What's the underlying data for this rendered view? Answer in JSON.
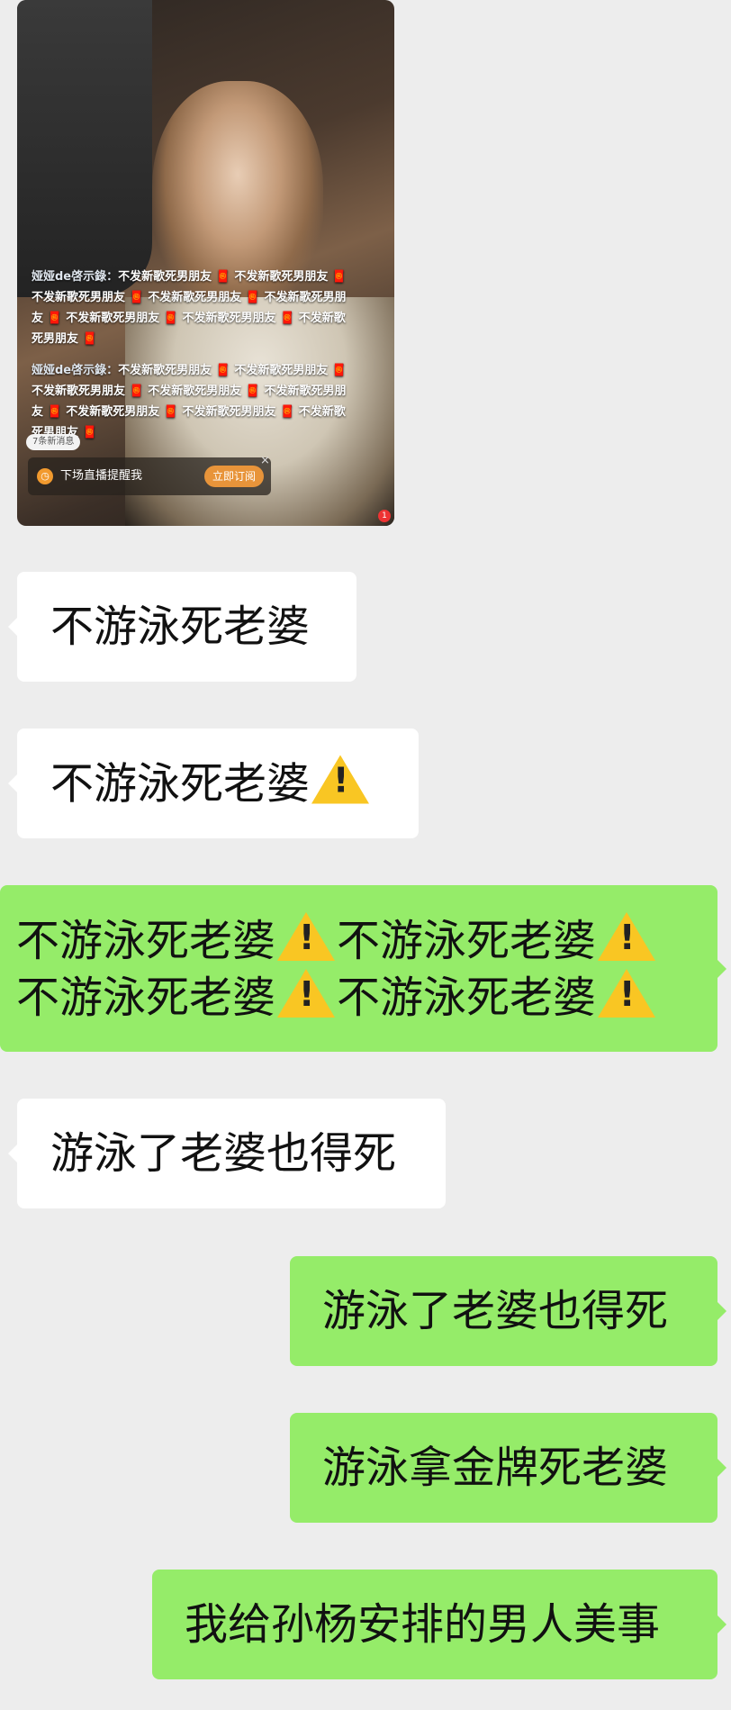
{
  "image_message": {
    "danmu_blocks": [
      {
        "user": "娅娅de啓示錄：",
        "text": "不发新歌死男朋友 🧧 不发新歌死男朋友 🧧 不发新歌死男朋友 🧧 不发新歌死男朋友 🧧 不发新歌死男朋友 🧧 不发新歌死男朋友 🧧 不发新歌死男朋友 🧧 不发新歌死男朋友 🧧"
      },
      {
        "user": "娅娅de啓示錄：",
        "text": "不发新歌死男朋友 🧧 不发新歌死男朋友 🧧 不发新歌死男朋友 🧧 不发新歌死男朋友 🧧 不发新歌死男朋友 🧧 不发新歌死男朋友 🧧 不发新歌死男朋友 🧧 不发新歌死男朋友 🧧"
      }
    ],
    "new_messages_label": "7条新消息",
    "remind_text": "下场直播提醒我",
    "subscribe_button": "立即订阅",
    "close_glyph": "×",
    "badge_count": "1"
  },
  "messages": [
    {
      "side": "received",
      "text": "不游泳死老婆"
    },
    {
      "side": "received",
      "text": "不游泳死老婆",
      "icon": "warning-icon"
    },
    {
      "side": "sent",
      "segments": [
        "不游泳死老婆",
        "不游泳死老婆",
        "不游泳死老婆",
        "不游泳死老婆"
      ],
      "icon": "warning-icon"
    },
    {
      "side": "received",
      "text": "游泳了老婆也得死"
    },
    {
      "side": "sent",
      "text": "游泳了老婆也得死"
    },
    {
      "side": "sent",
      "text": "游泳拿金牌死老婆"
    },
    {
      "side": "sent",
      "text": "我给孙杨安排的男人美事"
    }
  ],
  "colors": {
    "background": "#ededed",
    "received_bubble": "#ffffff",
    "sent_bubble": "#95ec69",
    "warning": "#f9c623"
  }
}
